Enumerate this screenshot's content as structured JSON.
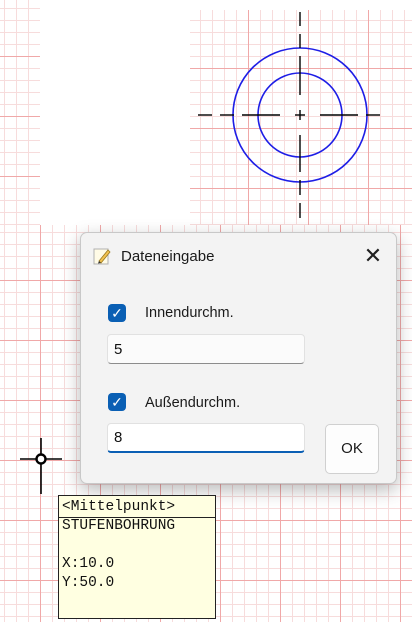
{
  "dialog": {
    "title": "Dateneingabe",
    "close_icon": "close-icon",
    "title_icon": "pencil-notepad-icon",
    "inner_checkbox_checked": true,
    "inner_label": "Innendurchm.",
    "inner_value": "5",
    "outer_checkbox_checked": true,
    "outer_label": "Außendurchm.",
    "outer_value": "8",
    "ok_label": "OK",
    "accent_color": "#0a5fb4"
  },
  "tooltip": {
    "header": "<Mittelpunkt>",
    "line1": "STUFENBOHRUNG",
    "line2": "",
    "x_text": "X:10.0",
    "y_text": "Y:50.0"
  },
  "canvas": {
    "grid_major_color": "#f0a8a8",
    "grid_minor_color": "#f7dcdc",
    "circle_color": "#1e1ee6",
    "crosshair_color": "#000000"
  }
}
